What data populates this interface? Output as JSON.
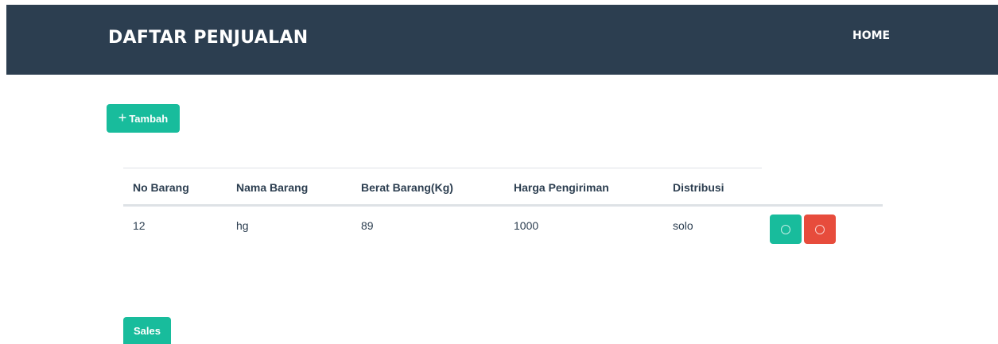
{
  "navbar": {
    "brand": "DAFTAR PENJUALAN",
    "home_label": "HOME"
  },
  "actions": {
    "add_icon": "plus-icon",
    "add_label": "Tambah",
    "sales_label": "Sales"
  },
  "table": {
    "headers": [
      "No Barang",
      "Nama Barang",
      "Berat Barang(Kg)",
      "Harga Pengiriman",
      "Distribusi"
    ],
    "rows": [
      {
        "cells": [
          "12",
          "hg",
          "89",
          "1000",
          "solo"
        ],
        "edit_icon": "edit-icon",
        "delete_icon": "delete-icon"
      }
    ]
  },
  "colors": {
    "navbar": "#2c3e50",
    "primary": "#18bc9c",
    "danger": "#e74c3c"
  }
}
